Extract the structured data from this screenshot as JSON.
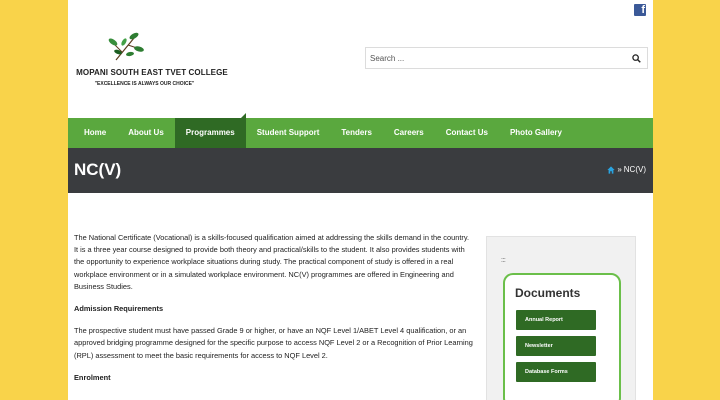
{
  "header": {
    "college_name": "MOPANI SOUTH EAST TVET COLLEGE",
    "motto": "\"EXCELLENCE IS ALWAYS OUR CHOICE\"",
    "facebook_icon": "facebook-icon",
    "facebook_glyph": "f"
  },
  "search": {
    "placeholder": "Search ...",
    "icon": "search-icon"
  },
  "nav": {
    "items": [
      {
        "label": "Home"
      },
      {
        "label": "About Us"
      },
      {
        "label": "Programmes"
      },
      {
        "label": "Student Support"
      },
      {
        "label": "Tenders"
      },
      {
        "label": "Careers"
      },
      {
        "label": "Contact Us"
      },
      {
        "label": "Photo Gallery"
      }
    ],
    "active": "Programmes"
  },
  "banner": {
    "title": "NC(V)",
    "breadcrumb_separator": "»",
    "breadcrumb_current": "NC(V)",
    "home_icon": "home-icon"
  },
  "content": {
    "intro": "The National Certificate (Vocational) is a skills-focused qualification aimed at addressing the skills demand in the country. It is a three year course designed to provide both theory and practical/skills to the student. It also provides students with the opportunity to experience workplace situations during study. The practical component of study is offered in a real workplace environment or in a simulated workplace environment. NC(V) programmes are offered in Engineering and Business Studies.",
    "admission_heading": "Admission Requirements",
    "admission_text": "The prospective student must have passed Grade 9 or higher, or have an NQF Level 1/ABET Level 4 qualification, or an approved bridging programme designed for the specific purpose to access NQF Level 2 or a Recognition of Prior Learning (RPL) assessment to meet the basic requirements for access to NQF Level 2.",
    "enrolment_heading": "Enrolment"
  },
  "sidebar": {
    "dots": ":::",
    "documents_title": "Documents",
    "buttons": [
      {
        "label": "Annual Report"
      },
      {
        "label": "Newsletter"
      },
      {
        "label": "Database Forms"
      }
    ]
  },
  "colors": {
    "page_background": "#f9d34a",
    "nav_green": "#5aa83e",
    "active_green": "#2f6a24",
    "banner_dark": "#3a3c3f",
    "facebook_blue": "#3b5998"
  }
}
